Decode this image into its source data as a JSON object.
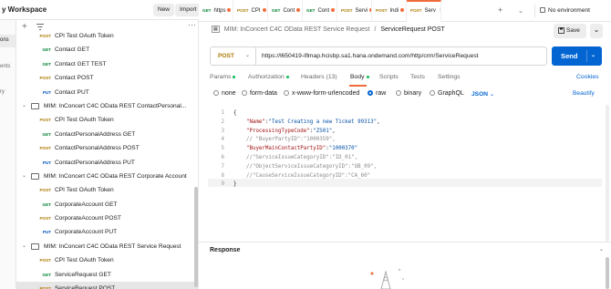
{
  "workspace": {
    "title": "y Workspace",
    "new_label": "New",
    "import_label": "Import"
  },
  "left_nav": [
    {
      "label": "ons",
      "active": true
    },
    {
      "label": "ents",
      "active": false
    },
    {
      "label": "ry",
      "active": false
    }
  ],
  "sidebar": {
    "rows": [
      {
        "type": "request",
        "method": "POST",
        "label": "CPI Test OAuth Token"
      },
      {
        "type": "request",
        "method": "GET",
        "label": "Contact GET"
      },
      {
        "type": "request",
        "method": "GET",
        "label": "Contact GET TEST"
      },
      {
        "type": "request",
        "method": "POST",
        "label": "Contact POST"
      },
      {
        "type": "request",
        "method": "PUT",
        "label": "Contact PUT"
      },
      {
        "type": "folder",
        "label": "MIM: InConcert C4C OData REST ContactPersonal..."
      },
      {
        "type": "request",
        "method": "POST",
        "label": "CPI Test OAuth Token"
      },
      {
        "type": "request",
        "method": "GET",
        "label": "ContactPersonalAddress GET"
      },
      {
        "type": "request",
        "method": "POST",
        "label": "ContactPersonalAddress POST"
      },
      {
        "type": "request",
        "method": "PUT",
        "label": "ContactPersonalAddress PUT"
      },
      {
        "type": "folder",
        "label": "MIM: InConcert C4C OData REST Corporate Account"
      },
      {
        "type": "request",
        "method": "POST",
        "label": "CPI Test OAuth Token"
      },
      {
        "type": "request",
        "method": "GET",
        "label": "CorporateAccount GET"
      },
      {
        "type": "request",
        "method": "POST",
        "label": "CorporateAccount POST"
      },
      {
        "type": "request",
        "method": "PUT",
        "label": "CorporateAccount PUT"
      },
      {
        "type": "folder",
        "label": "MIM: InConcert C4C OData REST Service Request"
      },
      {
        "type": "request",
        "method": "POST",
        "label": "CPI Test OAuth Token"
      },
      {
        "type": "request",
        "method": "GET",
        "label": "ServiceRequest GET"
      },
      {
        "type": "request",
        "method": "POST",
        "label": "ServiceRequest POST",
        "selected": true
      }
    ]
  },
  "tabs": [
    {
      "method": "GET",
      "label": "https",
      "dot": true
    },
    {
      "method": "POST",
      "label": "CPI",
      "dot": true
    },
    {
      "method": "GET",
      "label": "Cont",
      "dot": true
    },
    {
      "method": "GET",
      "label": "Cont",
      "dot": true
    },
    {
      "method": "POST",
      "label": "Servi",
      "dot": true
    },
    {
      "method": "POST",
      "label": "Indi",
      "dot": true
    },
    {
      "method": "POST",
      "label": "Serv",
      "dot": false,
      "active": true
    }
  ],
  "environment": {
    "label": "No environment"
  },
  "breadcrumb": {
    "parent": "MIM: InConcert C4C OData REST Service Request",
    "separator": "/",
    "current": "ServiceRequest POST"
  },
  "toolbar": {
    "save_label": "Save"
  },
  "request": {
    "method": "POST",
    "url": "https://l650419-iflmap.hcisbp.sa1.hana.ondemand.com/http/crm/ServiceRequest",
    "send_label": "Send"
  },
  "subtabs": [
    {
      "label": "Params",
      "dot": true
    },
    {
      "label": "Authorization",
      "dot": true
    },
    {
      "label": "Headers (13)",
      "dot": false
    },
    {
      "label": "Body",
      "dot": true,
      "active": true
    },
    {
      "label": "Scripts",
      "dot": false
    },
    {
      "label": "Tests",
      "dot": false
    },
    {
      "label": "Settings",
      "dot": false
    }
  ],
  "cookies_label": "Cookies",
  "body_types": [
    {
      "label": "none",
      "selected": false
    },
    {
      "label": "form-data",
      "selected": false
    },
    {
      "label": "x-www-form-urlencoded",
      "selected": false
    },
    {
      "label": "raw",
      "selected": true
    },
    {
      "label": "binary",
      "selected": false
    },
    {
      "label": "GraphQL",
      "selected": false
    }
  ],
  "format_label": "JSON",
  "beautify_label": "Beautify",
  "code_lines": [
    {
      "n": "1",
      "text": "{"
    },
    {
      "n": "2",
      "text": "    \"Name\":\"Test Creating a new Ticket 99313\","
    },
    {
      "n": "3",
      "text": "    \"ProcessingTypeCode\":\"ZS01\","
    },
    {
      "n": "4",
      "text": "    // \"BuyerPartyID\":\"1000359\","
    },
    {
      "n": "5",
      "text": "    \"BuyerMainContactPartyID\":\"1000370\""
    },
    {
      "n": "6",
      "text": "    //\"ServiceIssueCategoryID\":\"ID_01\","
    },
    {
      "n": "7",
      "text": "    //\"ObjectServiceIssueCategoryID\":\"OB_09\","
    },
    {
      "n": "8",
      "text": "    //\"CauseServiceIssueCategoryID\":\"CA_60\""
    },
    {
      "n": "9",
      "text": "}"
    }
  ],
  "response": {
    "title": "Response"
  },
  "colors": {
    "accent": "#f26b3a",
    "send": "#0265d2",
    "get": "#007f31",
    "post": "#ad7a03",
    "put": "#0053b8"
  }
}
